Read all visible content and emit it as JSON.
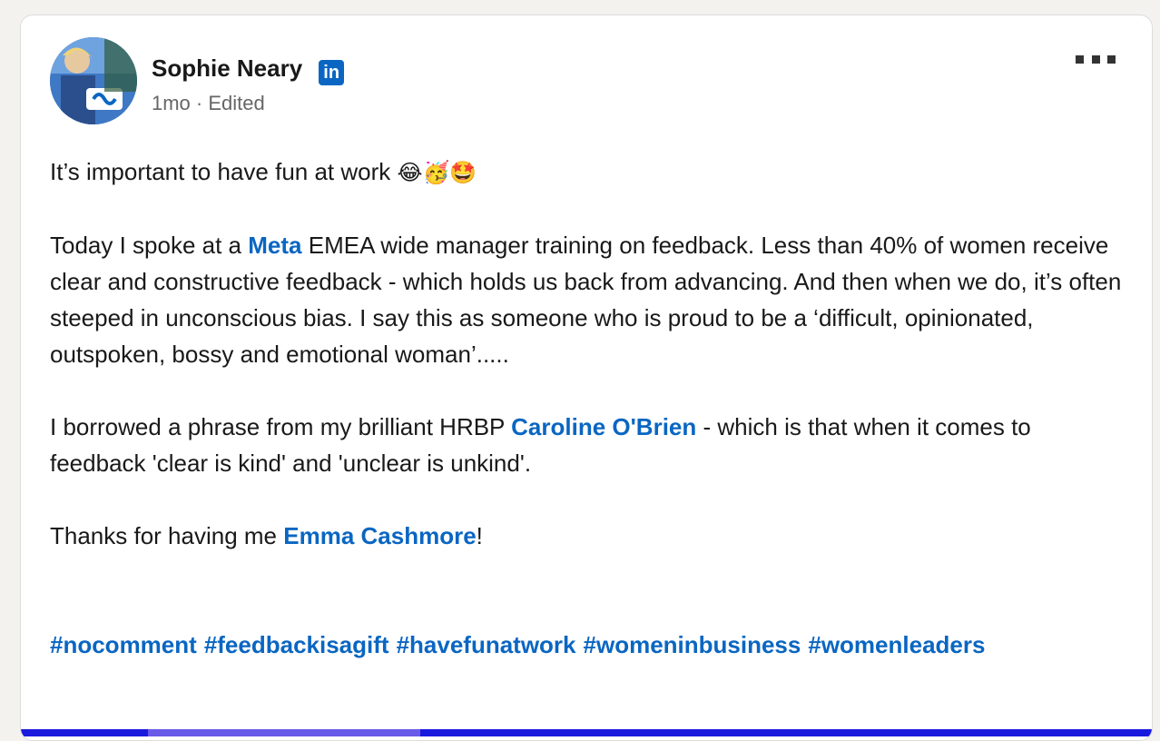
{
  "post": {
    "author": {
      "name": "Sophie Neary",
      "badge": "in",
      "time": "1mo",
      "separator": "·",
      "edited": "Edited"
    },
    "lines": {
      "intro": "It’s important to have fun at work",
      "intro_emojis": "😂🥳🤩",
      "p1_pre": "Today I spoke at a ",
      "p1_link": "Meta",
      "p1_post": " EMEA wide manager training on feedback. Less than 40% of women receive clear and constructive feedback - which holds us back from advancing. And then when we do, it’s often steeped in unconscious bias. I say this as someone who is proud to be a ‘difficult, opinionated, outspoken, bossy and emotional woman’.....",
      "p2_pre": "I borrowed a phrase from my brilliant HRBP ",
      "p2_link": "Caroline O'Brien",
      "p2_post": " - which is that when it comes to feedback 'clear is kind' and 'unclear is unkind'.",
      "p3_pre": "Thanks for having me ",
      "p3_link": "Emma Cashmore",
      "p3_post": "!"
    },
    "hashtags": [
      "#nocomment",
      "#feedbackisagift",
      "#havefunatwork",
      "#womeninbusiness",
      "#womenleaders"
    ]
  },
  "colors": {
    "link": "#0a66c2",
    "bottom_bar": "#1a1adf"
  },
  "icons": {
    "more": "more-icon",
    "linkedin": "linkedin-icon"
  }
}
